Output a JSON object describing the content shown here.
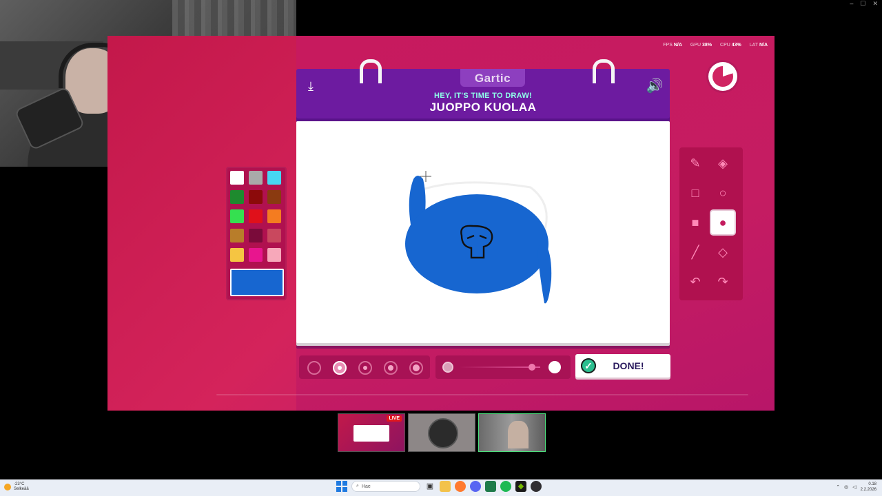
{
  "window": {
    "min": "–",
    "max": "☐",
    "close": "✕"
  },
  "stats": [
    {
      "key": "FPS",
      "value": "N/A"
    },
    {
      "key": "GPU",
      "value": "38%"
    },
    {
      "key": "CPU",
      "value": "43%"
    },
    {
      "key": "LAT",
      "value": "N/A"
    }
  ],
  "header": {
    "logo": "Gartic",
    "subtitle": "HEY, IT'S TIME TO DRAW!",
    "word": "JUOPPO KUOLAA",
    "download_icon": "download-icon",
    "volume_icon": "volume-icon"
  },
  "timer": {
    "remaining_fraction": 0.8
  },
  "palette": {
    "colors": [
      "#ffffff",
      "#a9a9a9",
      "#47d6f2",
      "#1e8a2e",
      "#8c0a0a",
      "#8a3a10",
      "#35e050",
      "#e0101a",
      "#f47c20",
      "#b87d2a",
      "#7a0b3a",
      "#c9485e",
      "#f5c542",
      "#e8158e",
      "#f7a8ba"
    ],
    "current": "#1766d0"
  },
  "tools": [
    {
      "name": "pencil",
      "icon": "✎"
    },
    {
      "name": "eraser",
      "icon": "◈"
    },
    {
      "name": "rectangle",
      "icon": "□"
    },
    {
      "name": "ellipse",
      "icon": "○"
    },
    {
      "name": "filled-rectangle",
      "icon": "■"
    },
    {
      "name": "filled-ellipse",
      "icon": "●"
    },
    {
      "name": "line",
      "icon": "╱"
    },
    {
      "name": "fill-bucket",
      "icon": "◇"
    },
    {
      "name": "undo",
      "icon": "↶"
    },
    {
      "name": "redo",
      "icon": "↷"
    }
  ],
  "selected_tool": "filled-ellipse",
  "brush_sizes": {
    "count": 5,
    "selected_index": 1
  },
  "opacity": {
    "value": 0.9
  },
  "done_button": {
    "label": "DONE!"
  },
  "thumbnails": {
    "live_badge": "LIVE"
  },
  "taskbar": {
    "weather_temp": "-23°C",
    "weather_desc": "Selkeää",
    "search_placeholder": "Hae",
    "time": "0.18",
    "date": "2.2.2026"
  }
}
